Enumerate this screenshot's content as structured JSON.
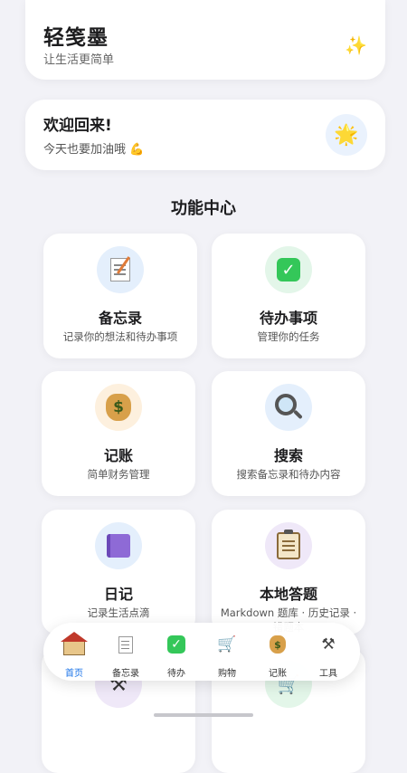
{
  "header": {
    "title": "轻笺墨",
    "subtitle": "让生活更简单",
    "sparkle_icon": "sparkles-icon"
  },
  "welcome": {
    "title": "欢迎回来!",
    "subtitle": "今天也要加油哦 💪",
    "badge_icon": "star-icon"
  },
  "section_title": "功能中心",
  "cards": [
    {
      "title": "备忘录",
      "desc": "记录你的想法和待办事项",
      "icon": "memo-icon"
    },
    {
      "title": "待办事项",
      "desc": "管理你的任务",
      "icon": "checkbox-icon"
    },
    {
      "title": "记账",
      "desc": "简单财务管理",
      "icon": "money-bag-icon"
    },
    {
      "title": "搜索",
      "desc": "搜索备忘录和待办内容",
      "icon": "magnifier-icon"
    },
    {
      "title": "日记",
      "desc": "记录生活点滴",
      "icon": "notebook-icon"
    },
    {
      "title": "本地答题",
      "desc": "Markdown 题库 · 历史记录 · 错题本",
      "icon": "clipboard-icon"
    },
    {
      "icon": "tools-icon"
    },
    {
      "icon": "cart-icon"
    }
  ],
  "tabbar": [
    {
      "label": "首页",
      "icon": "house-icon",
      "active": true
    },
    {
      "label": "备忘录",
      "icon": "memo-icon"
    },
    {
      "label": "待办",
      "icon": "checkbox-icon"
    },
    {
      "label": "购物",
      "icon": "cart-icon"
    },
    {
      "label": "记账",
      "icon": "money-bag-icon"
    },
    {
      "label": "工具",
      "icon": "tools-icon"
    }
  ],
  "colors": {
    "accent": "#1a73e8",
    "check_green": "#34c759",
    "background": "#f2f2f7"
  }
}
